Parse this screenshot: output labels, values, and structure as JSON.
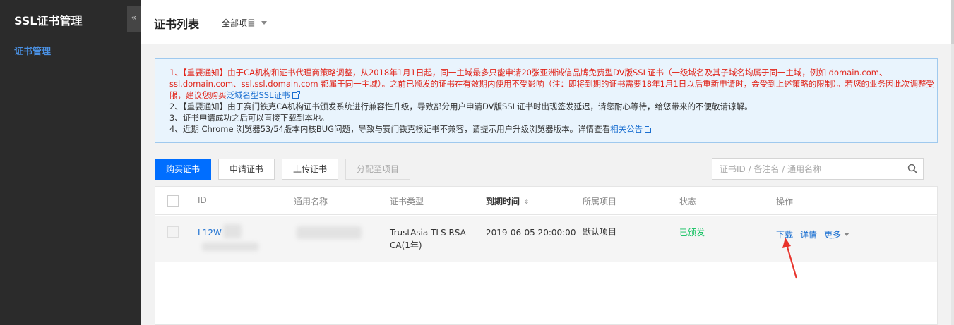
{
  "sidebar": {
    "title": "SSL证书管理",
    "collapse_label": "«",
    "items": [
      {
        "label": "证书管理"
      }
    ]
  },
  "header": {
    "title": "证书列表",
    "project_filter": "全部项目"
  },
  "notice": {
    "line1_prefix": "1、【重要通知】由于CA机构和证书代理商策略调整，从2018年1月1日起，同一主域最多只能申请20张亚洲诚信品牌免费型DV版SSL证书（一级域名及其子域名均属于同一主域，例如 domain.com、ssl.domain.com、ssl.ssl.domain.com 都属于同一主域）。之前已颁发的证书在有效期内使用不受影响（注：即将到期的证书需要18年1月1日以后重新申请时，会受到上述策略的限制）。若您的业务因此次调整受限，建议您购买",
    "line1_link": "泛域名型SSL证书",
    "line2": "2、【重要通知】由于赛门铁克CA机构证书颁发系统进行兼容性升级，导致部分用户申请DV版SSL证书时出现签发延迟，请您耐心等待，给您带来的不便敬请谅解。",
    "line3": "3、证书申请成功之后可以直接下载到本地。",
    "line4_prefix": "4、近期 Chrome 浏览器53/54版本内核BUG问题，导致与赛门铁克根证书不兼容，请提示用户升级浏览器版本。详情查看",
    "line4_link": "相关公告"
  },
  "toolbar": {
    "buy_label": "购买证书",
    "apply_label": "申请证书",
    "upload_label": "上传证书",
    "assign_label": "分配至项目",
    "search_placeholder": "证书ID / 备注名 / 通用名称"
  },
  "table": {
    "columns": [
      "ID",
      "通用名称",
      "证书类型",
      "到期时间",
      "所属项目",
      "状态",
      "操作"
    ],
    "rows": [
      {
        "id": "L12W",
        "common_name": "",
        "cert_type_line1": "TrustAsia TLS RSA",
        "cert_type_line2": "CA(1年)",
        "expire": "2019-06-05 20:00:00",
        "project": "默认项目",
        "status": "已颁发",
        "actions": {
          "download": "下载",
          "detail": "详情",
          "more": "更多"
        }
      }
    ]
  },
  "colors": {
    "primary": "#006eff",
    "link": "#1a6fd1",
    "notice_red": "#e1251b",
    "status_green": "#0abf5b",
    "sidebar_bg": "#2b2b2b",
    "annotation": "#e8322a"
  }
}
